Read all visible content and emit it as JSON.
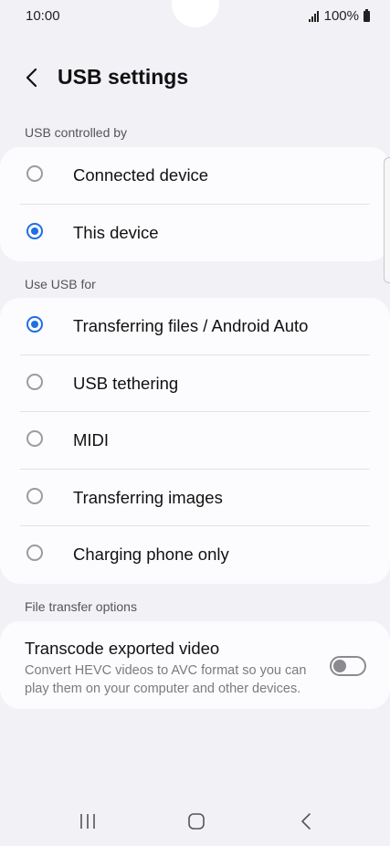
{
  "status_bar": {
    "time": "10:00",
    "battery": "100%"
  },
  "header": {
    "title": "USB settings"
  },
  "usb_controlled_by": {
    "label": "USB controlled by",
    "options": [
      {
        "label": "Connected device",
        "selected": false
      },
      {
        "label": "This device",
        "selected": true
      }
    ]
  },
  "use_usb_for": {
    "label": "Use USB for",
    "options": [
      {
        "label": "Transferring files / Android Auto",
        "selected": true
      },
      {
        "label": "USB tethering",
        "selected": false
      },
      {
        "label": "MIDI",
        "selected": false
      },
      {
        "label": "Transferring images",
        "selected": false
      },
      {
        "label": "Charging phone only",
        "selected": false
      }
    ]
  },
  "file_transfer_options": {
    "label": "File transfer options",
    "transcode": {
      "title": "Transcode exported video",
      "description": "Convert HEVC videos to AVC format so you can play them on your computer and other devices.",
      "enabled": false
    }
  },
  "colors": {
    "accent": "#1f6fe0",
    "background": "#f2f2f6",
    "card": "#fcfcfe"
  },
  "nav_icons": [
    "recents-icon",
    "home-icon",
    "back-icon"
  ]
}
